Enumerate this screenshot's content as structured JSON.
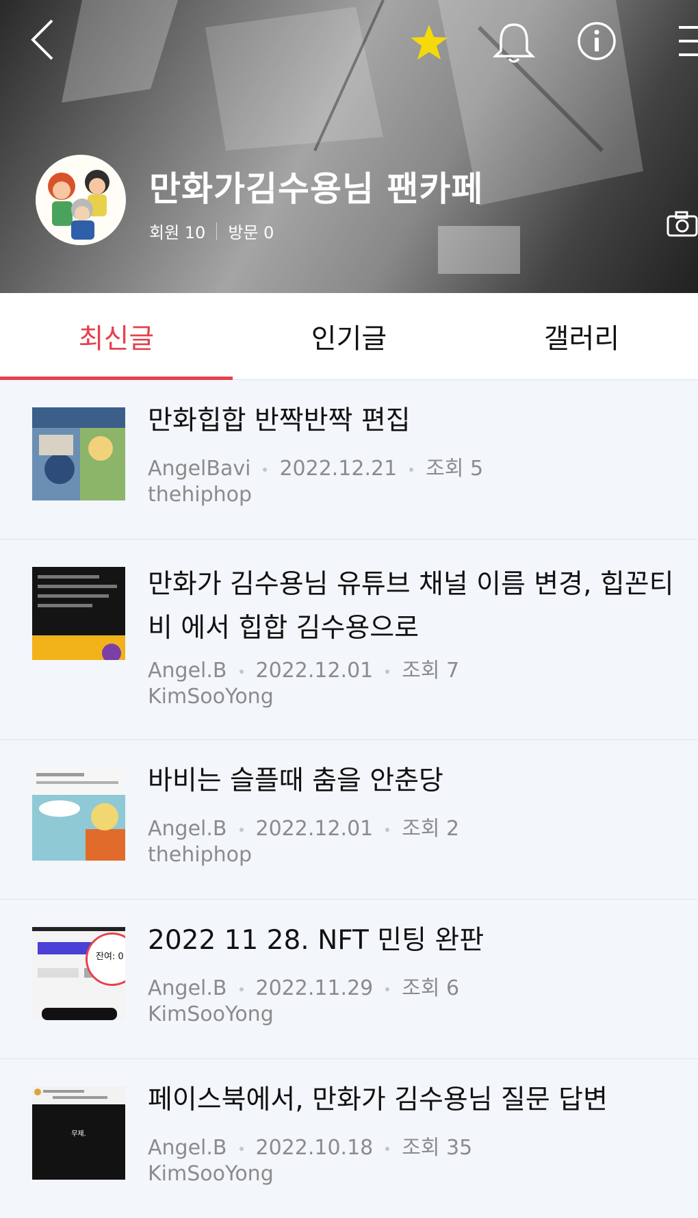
{
  "cafe": {
    "name": "만화가김수용님 팬카페",
    "members_label": "회원 10",
    "visits_label": "방문 0"
  },
  "tabs": [
    {
      "label": "최신글"
    },
    {
      "label": "인기글"
    },
    {
      "label": "갤러리"
    }
  ],
  "posts": [
    {
      "title": "만화힙합 반짝반짝 편집",
      "author": "AngelBavi",
      "date": "2022.12.21",
      "views": "조회 5",
      "board": "thehiphop"
    },
    {
      "title": "만화가 김수용님 유튜브 채널 이름 변경, 힙꼰티비 에서 힙합 김수용으로",
      "author": "Angel.B",
      "date": "2022.12.01",
      "views": "조회 7",
      "board": "KimSooYong"
    },
    {
      "title": "바비는 슬플때 춤을 안춘당",
      "author": "Angel.B",
      "date": "2022.12.01",
      "views": "조회 2",
      "board": "thehiphop"
    },
    {
      "title": "2022 11 28. NFT 민팅 완판",
      "author": "Angel.B",
      "date": "2022.11.29",
      "views": "조회 6",
      "board": "KimSooYong",
      "thumb_text": "잔여: 0"
    },
    {
      "title": "페이스북에서, 만화가 김수용님 질문 답변",
      "author": "Angel.B",
      "date": "2022.10.18",
      "views": "조회 35",
      "board": "KimSooYong",
      "thumb_text": "무제."
    }
  ],
  "icons": [
    "back-arrow-icon",
    "favorite-star-icon",
    "notification-bell-icon",
    "info-icon",
    "menu-icon",
    "camera-icon"
  ],
  "colors": {
    "accent": "#e5424d",
    "star": "#f5d90a"
  }
}
